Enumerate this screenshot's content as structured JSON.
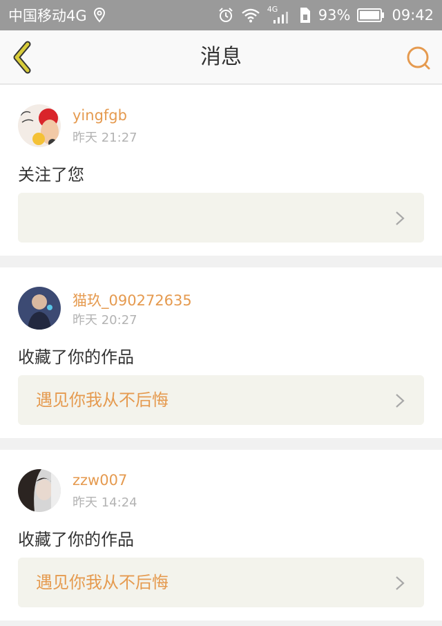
{
  "status_bar": {
    "carrier": "中国移动4G",
    "network": "4G",
    "battery": "93%",
    "time": "09:42"
  },
  "nav": {
    "title": "消息"
  },
  "messages": [
    {
      "username": "yingfgb",
      "time": "昨天 21:27",
      "action": "关注了您",
      "ref": ""
    },
    {
      "username": "猫玖_090272635",
      "time": "昨天 20:27",
      "action": "收藏了你的作品",
      "ref": "遇见你我从不后悔"
    },
    {
      "username": "zzw007",
      "time": "昨天 14:24",
      "action": "收藏了你的作品",
      "ref": "遇见你我从不后悔"
    }
  ],
  "colors": {
    "accent": "#e59a4f",
    "back_icon": "#d8cc3a",
    "status_bar_bg": "#9a9a9a"
  }
}
